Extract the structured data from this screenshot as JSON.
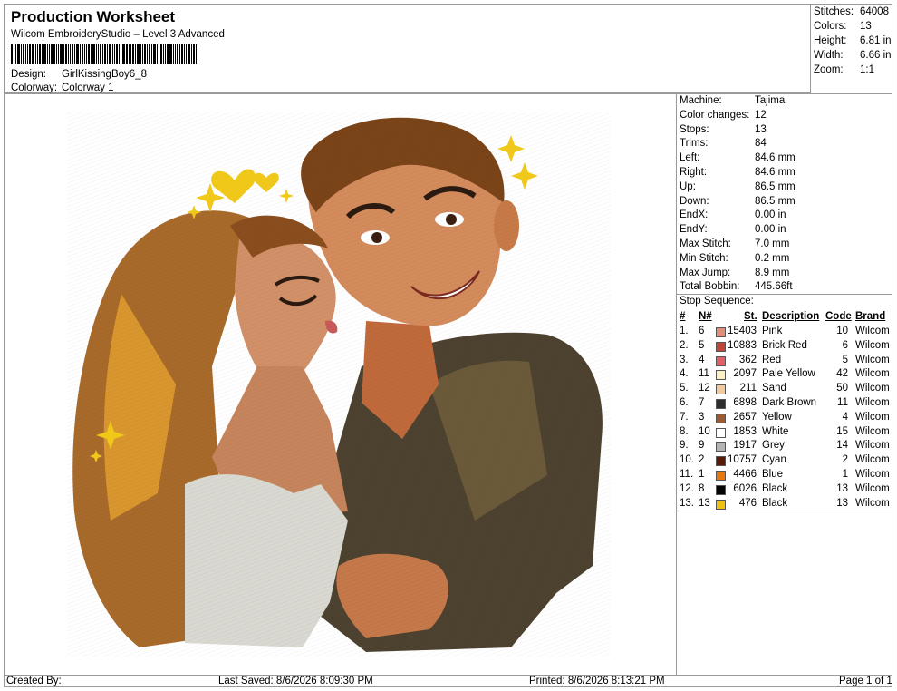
{
  "header": {
    "title": "Production Worksheet",
    "software": "Wilcom EmbroideryStudio – Level 3 Advanced",
    "design_label": "Design:",
    "design_value": "GirlKissingBoy6_8",
    "colorway_label": "Colorway:",
    "colorway_value": "Colorway 1"
  },
  "stats": {
    "stitches_label": "Stitches:",
    "stitches": "64008",
    "colors_label": "Colors:",
    "colors": "13",
    "height_label": "Height:",
    "height": "6.81 in",
    "width_label": "Width:",
    "width": "6.66 in",
    "zoom_label": "Zoom:",
    "zoom": "1:1"
  },
  "machine": [
    {
      "label": "Machine:",
      "value": "Tajima"
    },
    {
      "label": "Color changes:",
      "value": "12"
    },
    {
      "label": "Stops:",
      "value": "13"
    },
    {
      "label": "Trims:",
      "value": "84"
    },
    {
      "label": "Left:",
      "value": "84.6 mm"
    },
    {
      "label": "Right:",
      "value": "84.6 mm"
    },
    {
      "label": "Up:",
      "value": "86.5 mm"
    },
    {
      "label": "Down:",
      "value": "86.5 mm"
    },
    {
      "label": "EndX:",
      "value": "0.00 in"
    },
    {
      "label": "EndY:",
      "value": "0.00 in"
    },
    {
      "label": "Max Stitch:",
      "value": "7.0 mm"
    },
    {
      "label": "Min Stitch:",
      "value": "0.2 mm"
    },
    {
      "label": "Max Jump:",
      "value": "8.9 mm"
    },
    {
      "label": "Total Bobbin:",
      "value": "445.66ft"
    }
  ],
  "stop_sequence": {
    "title": "Stop Sequence:",
    "headers": {
      "num": "#",
      "needle": "N#",
      "st": "St.",
      "desc": "Description",
      "code": "Code",
      "brand": "Brand"
    },
    "rows": [
      {
        "num": "1.",
        "needle": "6",
        "color": "#e0907a",
        "st": "15403",
        "desc": "Pink",
        "code": "10",
        "brand": "Wilcom"
      },
      {
        "num": "2.",
        "needle": "5",
        "color": "#c0463a",
        "st": "10883",
        "desc": "Brick Red",
        "code": "6",
        "brand": "Wilcom"
      },
      {
        "num": "3.",
        "needle": "4",
        "color": "#e0606a",
        "st": "362",
        "desc": "Red",
        "code": "5",
        "brand": "Wilcom"
      },
      {
        "num": "4.",
        "needle": "11",
        "color": "#fbf1c4",
        "st": "2097",
        "desc": "Pale Yellow",
        "code": "42",
        "brand": "Wilcom"
      },
      {
        "num": "5.",
        "needle": "12",
        "color": "#f1c8a0",
        "st": "211",
        "desc": "Sand",
        "code": "50",
        "brand": "Wilcom"
      },
      {
        "num": "6.",
        "needle": "7",
        "color": "#2e2c2c",
        "st": "6898",
        "desc": "Dark Brown",
        "code": "11",
        "brand": "Wilcom"
      },
      {
        "num": "7.",
        "needle": "3",
        "color": "#9b5a30",
        "st": "2657",
        "desc": "Yellow",
        "code": "4",
        "brand": "Wilcom"
      },
      {
        "num": "8.",
        "needle": "10",
        "color": "#ffffff",
        "st": "1853",
        "desc": "White",
        "code": "15",
        "brand": "Wilcom"
      },
      {
        "num": "9.",
        "needle": "9",
        "color": "#b4b4b4",
        "st": "1917",
        "desc": "Grey",
        "code": "14",
        "brand": "Wilcom"
      },
      {
        "num": "10.",
        "needle": "2",
        "color": "#5a1a08",
        "st": "10757",
        "desc": "Cyan",
        "code": "2",
        "brand": "Wilcom"
      },
      {
        "num": "11.",
        "needle": "1",
        "color": "#e8780c",
        "st": "4466",
        "desc": "Blue",
        "code": "1",
        "brand": "Wilcom"
      },
      {
        "num": "12.",
        "needle": "8",
        "color": "#050505",
        "st": "6026",
        "desc": "Black",
        "code": "13",
        "brand": "Wilcom"
      },
      {
        "num": "13.",
        "needle": "13",
        "color": "#f0c010",
        "st": "476",
        "desc": "Black",
        "code": "13",
        "brand": "Wilcom"
      }
    ]
  },
  "footer": {
    "created_by": "Created By:",
    "last_saved": "Last Saved: 8/6/2026 8:09:30 PM",
    "printed": "Printed: 8/6/2026 8:13:21 PM",
    "page": "Page 1 of 1"
  }
}
